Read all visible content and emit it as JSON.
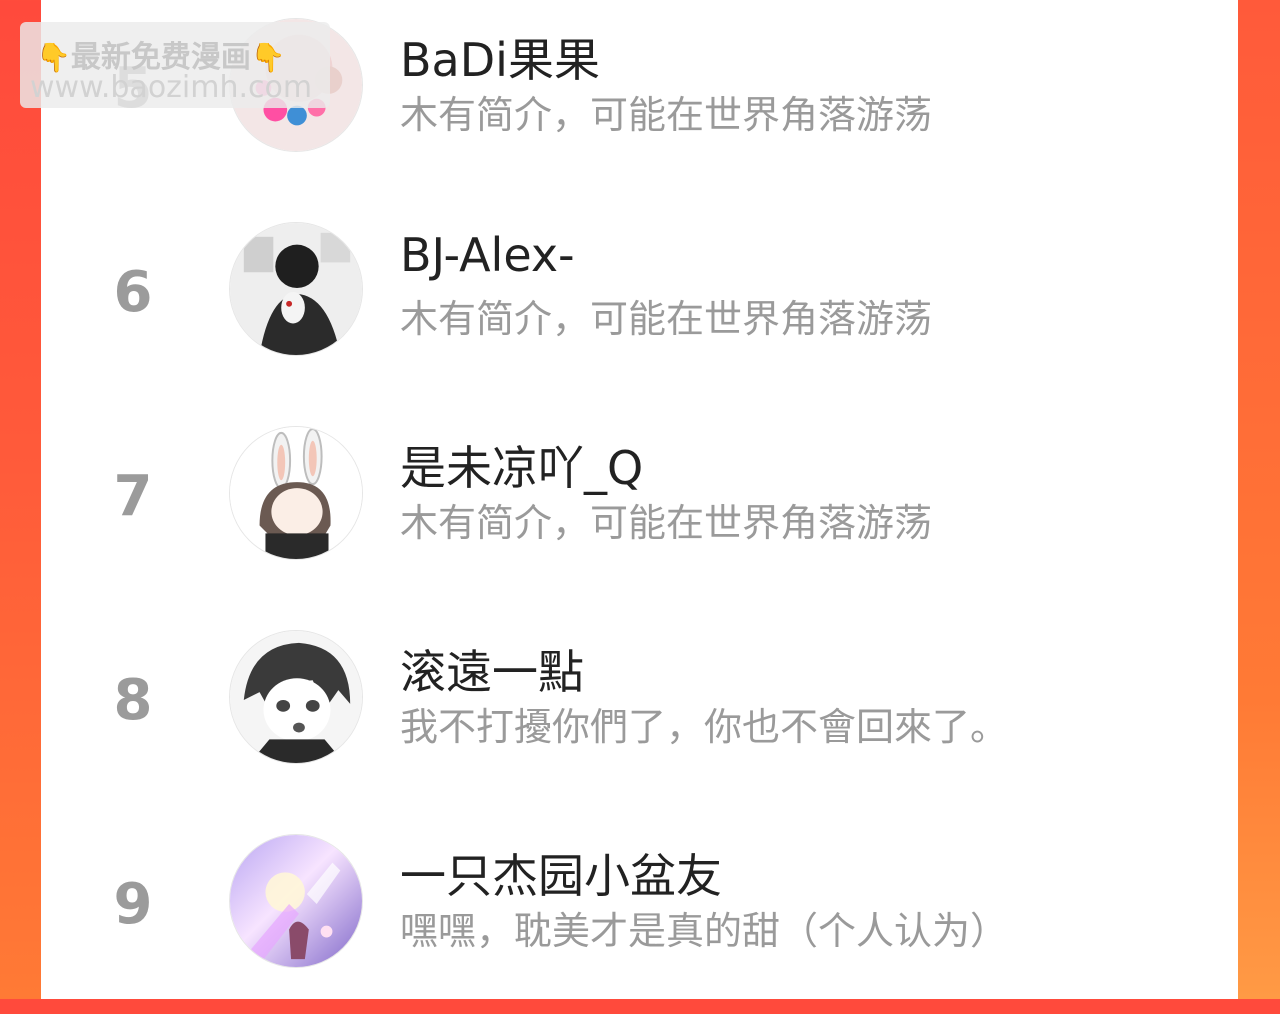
{
  "watermark": {
    "line1_left_icon": "pointing-hand-down",
    "line1_text": "最新免费漫画",
    "line1_right_icon": "pointing-hand-down",
    "line2_text": "www.baozimh.com"
  },
  "ranking": [
    {
      "rank": "5",
      "name": "BaDi果果",
      "bio": "木有简介，可能在世界角落游荡"
    },
    {
      "rank": "6",
      "name": "BJ-Alex-",
      "bio": "木有简介，可能在世界角落游荡"
    },
    {
      "rank": "7",
      "name": "是未凉吖_Q",
      "bio": "木有简介，可能在世界角落游荡"
    },
    {
      "rank": "8",
      "name": "滚遠一點",
      "bio": "我不打擾你們了，你也不會回來了。"
    },
    {
      "rank": "9",
      "name": "一只杰园小盆友",
      "bio": "嘿嘿，耽美才是真的甜（个人认为）"
    }
  ],
  "colors": {
    "background_accent": "#ff4a3c",
    "card": "#ffffff",
    "rank_number": "#9b9b9b",
    "name_text": "#222222",
    "bio_text": "#9a9a9a"
  }
}
